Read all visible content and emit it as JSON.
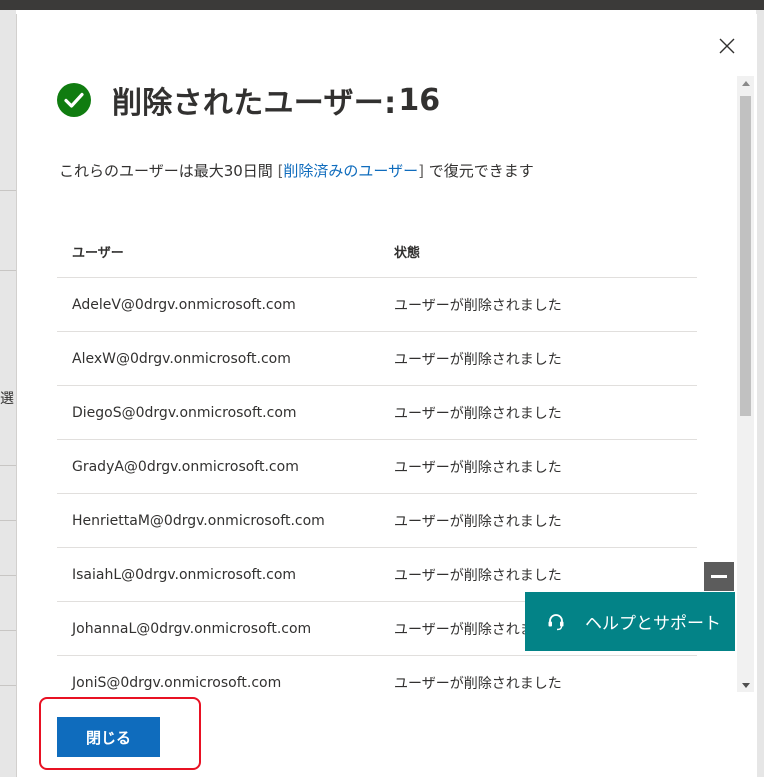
{
  "background": {
    "partial_char": "選"
  },
  "dialog": {
    "title": "削除されたユーザー:",
    "count": "16",
    "description_prefix": "これらのユーザーは最大30日間 ",
    "bracket_open": "[",
    "link_text": "削除済みのユーザー",
    "bracket_close": "]",
    "description_suffix": " で復元できます",
    "close_icon": "close-icon",
    "close_button_label": "閉じる"
  },
  "table": {
    "headers": [
      "ユーザー",
      "状態"
    ],
    "rows": [
      [
        "AdeleV@0drgv.onmicrosoft.com",
        "ユーザーが削除されました"
      ],
      [
        "AlexW@0drgv.onmicrosoft.com",
        "ユーザーが削除されました"
      ],
      [
        "DiegoS@0drgv.onmicrosoft.com",
        "ユーザーが削除されました"
      ],
      [
        "GradyA@0drgv.onmicrosoft.com",
        "ユーザーが削除されました"
      ],
      [
        "HenriettaM@0drgv.onmicrosoft.com",
        "ユーザーが削除されました"
      ],
      [
        "IsaiahL@0drgv.onmicrosoft.com",
        "ユーザーが削除されました"
      ],
      [
        "JohannaL@0drgv.onmicrosoft.com",
        "ユーザーが削除されました"
      ],
      [
        "JoniS@0drgv.onmicrosoft.com",
        "ユーザーが削除されました"
      ]
    ]
  },
  "help": {
    "label": "ヘルプとサポート",
    "icon": "headset-icon",
    "minimize_icon": "minimize-icon"
  },
  "colors": {
    "accent": "#0f6cbd",
    "success": "#107c10",
    "help_bg": "#038387",
    "highlight": "#e81123"
  }
}
